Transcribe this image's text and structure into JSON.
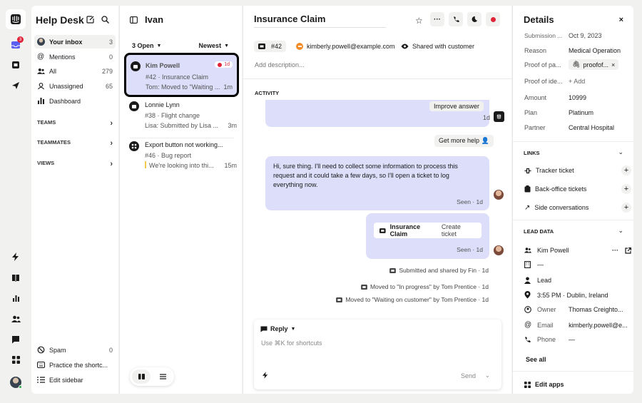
{
  "colors": {
    "accent": "#5b5ef0",
    "bubble": "#dcdefa",
    "selected": "#dcdefa",
    "danger": "#e0243a",
    "orange": "#f28c28"
  },
  "rail": {
    "badge": "3"
  },
  "sidebar": {
    "title": "Help Desk",
    "items": [
      {
        "label": "Your inbox",
        "count": "3"
      },
      {
        "label": "Mentions",
        "count": "0"
      },
      {
        "label": "All",
        "count": "279"
      },
      {
        "label": "Unassigned",
        "count": "65"
      },
      {
        "label": "Dashboard",
        "count": ""
      }
    ],
    "sections": [
      "TEAMS",
      "TEAMMATES",
      "VIEWS"
    ],
    "bottom": [
      {
        "label": "Spam",
        "count": "0"
      },
      {
        "label": "Practice the shortc...",
        "count": ""
      },
      {
        "label": "Edit sidebar",
        "count": ""
      }
    ]
  },
  "list": {
    "title": "Ivan",
    "filter": "3 Open",
    "sort": "Newest",
    "conversations": [
      {
        "name": "Kim Powell",
        "subject": "#42 · Insurance Claim",
        "preview": "Tom: Moved to \"Waiting ...",
        "time": "1m",
        "badge": "1d"
      },
      {
        "name": "Lonnie Lynn",
        "subject": "#38 · Flight change",
        "preview": "Lisa: Submitted by Lisa ...",
        "time": "3m",
        "badge": ""
      },
      {
        "name": "Export button not working...",
        "subject": "#46 · Bug report",
        "preview": "We're looking into thi...",
        "time": "15m",
        "badge": ""
      }
    ]
  },
  "main": {
    "title": "Insurance Claim",
    "ticket_id": "#42",
    "email": "kimberly.powell@example.com",
    "shared": "Shared with customer",
    "description_placeholder": "Add description...",
    "activity": "ACTIVITY",
    "improve": "Improve answer",
    "improve_time": "1d",
    "get_more_help": "Get more help 👤",
    "message": "Hi, sure thing. I'll need to collect some information to process this request and it could take a few days, so I'll open a ticket to log everything now.",
    "seen1": "Seen · 1d",
    "ticket_card_name": "Insurance Claim",
    "ticket_card_action": "Create ticket",
    "seen2": "Seen · 1d",
    "events": [
      "Submitted and shared by Fin · 1d",
      "Moved to \"In progress\" by Tom Prentice · 1d",
      "Moved to \"Waiting on customer\" by Tom Prentice · 1d"
    ],
    "reply": {
      "mode": "Reply",
      "placeholder": "Use ⌘K for shortcuts",
      "send": "Send"
    }
  },
  "details": {
    "title": "Details",
    "fields": [
      {
        "k": "Submission ...",
        "v": "Oct 9, 2023"
      },
      {
        "k": "Reason",
        "v": "Medical Operation"
      },
      {
        "k": "Proof of pa...",
        "v": "proofof..."
      },
      {
        "k": "Proof of ide...",
        "v": "+ Add"
      },
      {
        "k": "Amount",
        "v": "10999"
      },
      {
        "k": "Plan",
        "v": "Platinum"
      },
      {
        "k": "Partner",
        "v": "Central Hospital"
      }
    ],
    "links_title": "LINKS",
    "links": [
      "Tracker ticket",
      "Back-office tickets",
      "Side conversations"
    ],
    "lead_title": "LEAD DATA",
    "lead_name": "Kim Powell",
    "lead_company": "—",
    "lead_type": "Lead",
    "lead_location": "3:55 PM · Dublin, Ireland",
    "lead_fields": [
      {
        "k": "Owner",
        "v": "Thomas Creighto..."
      },
      {
        "k": "Email",
        "v": "kimberly.powell@e..."
      },
      {
        "k": "Phone",
        "v": "—"
      }
    ],
    "see_all": "See all",
    "edit_apps": "Edit apps"
  }
}
